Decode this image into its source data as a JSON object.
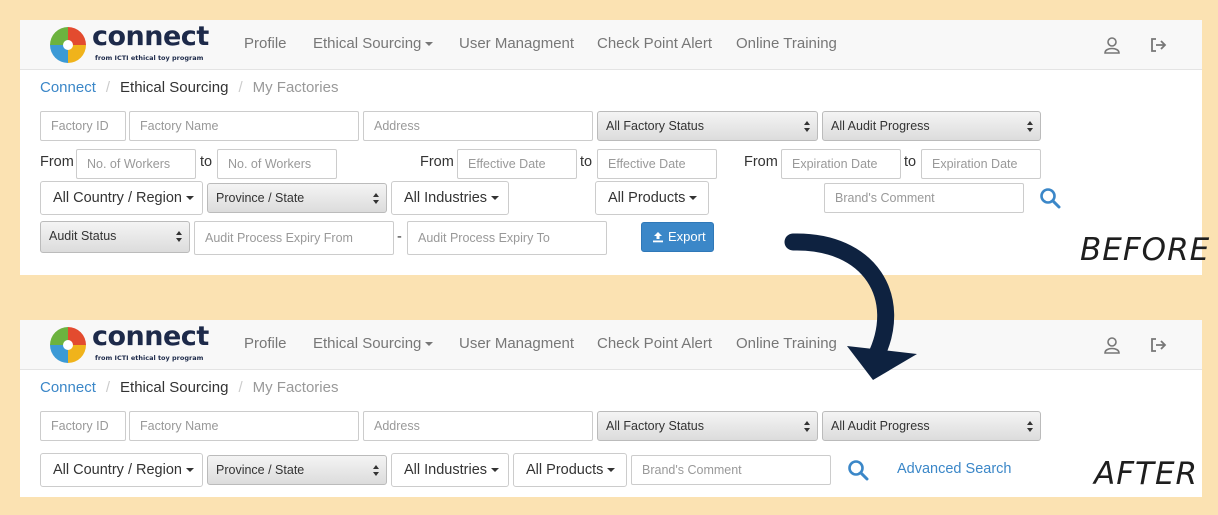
{
  "app": {
    "logo_word": "connect",
    "logo_sub": "from ICTI ethical toy program",
    "nav": [
      {
        "label": "Profile",
        "icon": ""
      },
      {
        "label": "Ethical Sourcing",
        "icon": "caret-down-icon"
      },
      {
        "label": "User Managment",
        "icon": ""
      },
      {
        "label": "Check Point Alert",
        "icon": ""
      },
      {
        "label": "Online Training",
        "icon": ""
      }
    ],
    "nav_icons": [
      "user-icon",
      "logout-icon"
    ]
  },
  "breadcrumb": {
    "root": "Connect",
    "section": "Ethical Sourcing",
    "current": "My Factories"
  },
  "filters": {
    "factory_id_placeholder": "Factory ID",
    "factory_name_placeholder": "Factory Name",
    "address_placeholder": "Address",
    "factory_status": "All Factory Status",
    "audit_progress": "All Audit Progress",
    "from_label": "From",
    "to_label": "to",
    "workers_placeholder": "No. of Workers",
    "effective_date_placeholder": "Effective Date",
    "expiration_date_placeholder": "Expiration Date",
    "country_region": "All Country / Region",
    "province_state": "Province / State",
    "industries": "All Industries",
    "products": "All Products",
    "brands_comment_placeholder": "Brand's Comment",
    "audit_status": "Audit Status",
    "audit_expiry_from_placeholder": "Audit Process Expiry From",
    "audit_expiry_to_placeholder": "Audit Process Expiry To",
    "range_dash": "-",
    "export_label": "Export",
    "advanced_search_label": "Advanced Search"
  },
  "labels": {
    "before": "BEFORE",
    "after": "AFTER"
  },
  "colors": {
    "background": "#fbe2b2",
    "accent": "#3b87c8",
    "arrow": "#0e2240"
  }
}
